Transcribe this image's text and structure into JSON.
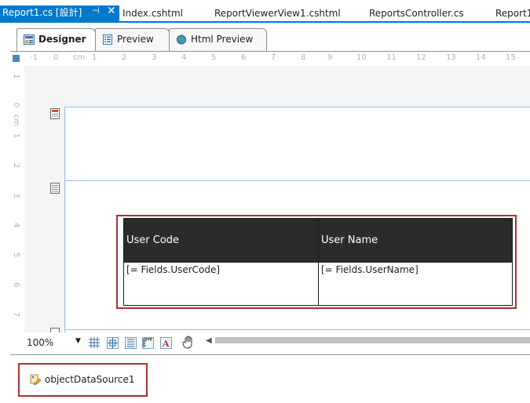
{
  "document_tabs": {
    "active": {
      "label": "Report1.cs [設計]",
      "pin_icon": "pin-icon",
      "close_icon": "close-icon"
    },
    "others": [
      "Index.cshtml",
      "ReportViewerView1.cshtml",
      "ReportsController.cs",
      "Report1"
    ]
  },
  "designer_tabs": [
    {
      "label": "Designer",
      "icon": "designer-icon"
    },
    {
      "label": "Preview",
      "icon": "preview-icon"
    },
    {
      "label": "Html Preview",
      "icon": "globe-icon"
    }
  ],
  "ruler": {
    "horizontal": [
      "-1",
      "0",
      "cm",
      "1",
      "2",
      "3",
      "4",
      "5",
      "6",
      "7",
      "8",
      "9",
      "10",
      "11",
      "12",
      "13",
      "14",
      "15"
    ],
    "vertical": [
      "1",
      "0",
      "cm",
      "1",
      "2",
      "3",
      "4",
      "5",
      "6",
      "7"
    ]
  },
  "table": {
    "headers": [
      "User Code",
      "User Name"
    ],
    "cells": [
      "[= Fields.UserCode]",
      "[= Fields.UserName]"
    ]
  },
  "toolbar": {
    "zoom": "100%",
    "icons": [
      "grid-icon",
      "snap-icon",
      "report-explorer-icon",
      "ruler-icon",
      "font-icon",
      "hand-icon"
    ]
  },
  "tray": {
    "component_label": "objectDataSource1"
  },
  "colors": {
    "accent": "#007acc",
    "highlight": "#b03030",
    "table_header": "#2b2b2b"
  }
}
